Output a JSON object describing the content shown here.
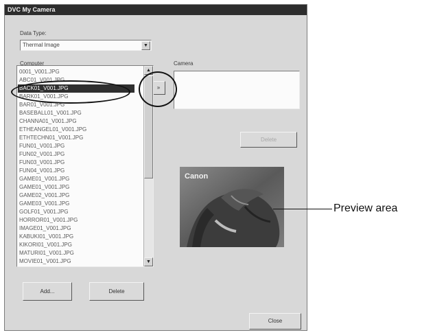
{
  "window": {
    "title": "DVC My Camera"
  },
  "data_type": {
    "label": "Data Type:",
    "value": "Thermal Image"
  },
  "computer": {
    "label": "Computer",
    "files": [
      "0001_V001.JPG",
      "ABC01_V001.JPG",
      "BACK01_V001.JPG",
      "BARK01_V001.JPG",
      "BAR01_V001.JPG",
      "BASEBALL01_V001.JPG",
      "CHANNA01_V001.JPG",
      "ETHEANGEL01_V001.JPG",
      "ETHTECHN01_V001.JPG",
      "FUN01_V001.JPG",
      "FUN02_V001.JPG",
      "FUN03_V001.JPG",
      "FUN04_V001.JPG",
      "GAME01_V001.JPG",
      "GAME01_V001.JPG",
      "GAME02_V001.JPG",
      "GAME03_V001.JPG",
      "GOLF01_V001.JPG",
      "HORROR01_V001.JPG",
      "IMAGE01_V001.JPG",
      "KABUKI01_V001.JPG",
      "KIKORI01_V001.JPG",
      "MATURI01_V001.JPG",
      "MOVIE01_V001.JPG"
    ],
    "selected_index": 2
  },
  "transfer_button": {
    "label": "»"
  },
  "camera": {
    "label": "Camera",
    "delete_label": "Delete"
  },
  "preview": {
    "brand": "Canon",
    "callout": "Preview area"
  },
  "buttons": {
    "add": "Add...",
    "delete": "Delete",
    "close": "Close"
  }
}
